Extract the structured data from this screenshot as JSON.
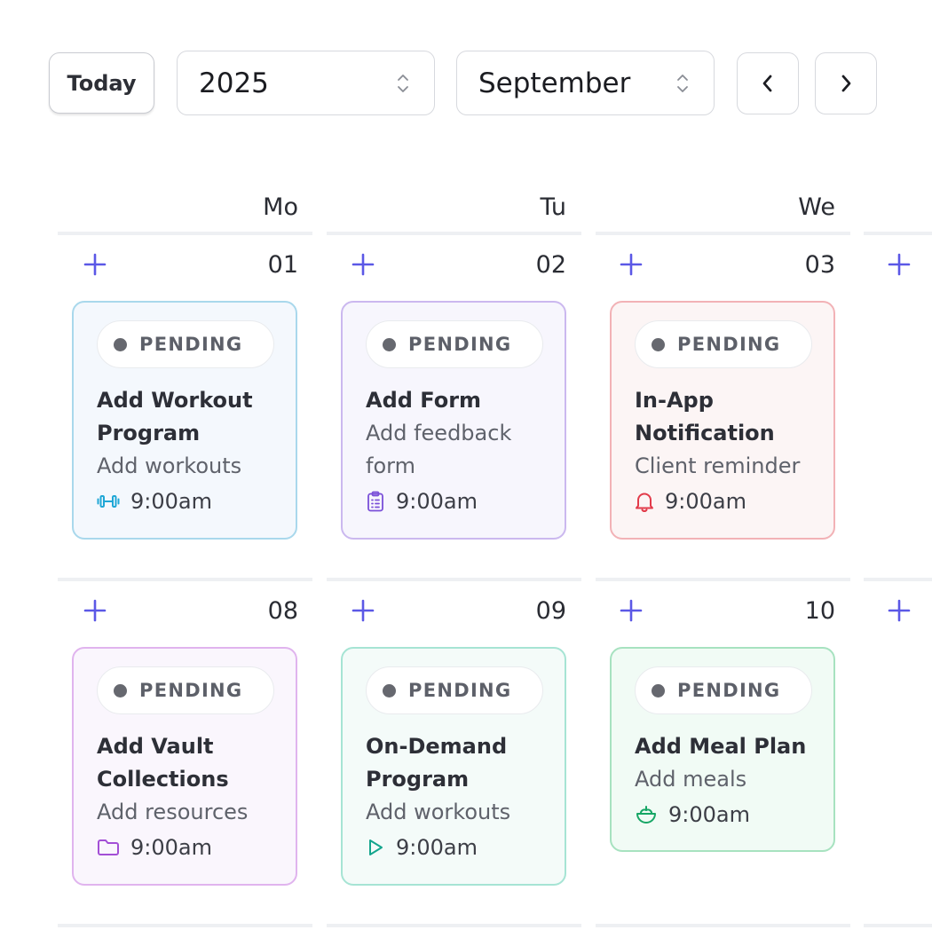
{
  "toolbar": {
    "today_label": "Today",
    "year_value": "2025",
    "month_value": "September"
  },
  "day_headers": [
    "Mo",
    "Tu",
    "We"
  ],
  "weeks": [
    {
      "dates": [
        "01",
        "02",
        "03"
      ]
    },
    {
      "dates": [
        "08",
        "09",
        "10"
      ]
    }
  ],
  "events": [
    {
      "status": "PENDING",
      "title": "Add Workout Program",
      "subtitle": "Add workouts",
      "time": "9:00am",
      "icon": "dumbbell-icon",
      "accent": "#1fa7d6"
    },
    {
      "status": "PENDING",
      "title": "Add Form",
      "subtitle": "Add feedback form",
      "time": "9:00am",
      "icon": "clipboard-icon",
      "accent": "#7a4fd8"
    },
    {
      "status": "PENDING",
      "title": "In-App Notification",
      "subtitle": "Client reminder",
      "time": "9:00am",
      "icon": "bell-icon",
      "accent": "#e23b4a"
    },
    {
      "status": "PENDING",
      "title": "Add Vault Collections",
      "subtitle": "Add resources",
      "time": "9:00am",
      "icon": "folder-icon",
      "accent": "#a34fd6"
    },
    {
      "status": "PENDING",
      "title": "On-Demand Program",
      "subtitle": "Add workouts",
      "time": "9:00am",
      "icon": "play-icon",
      "accent": "#14a58d"
    },
    {
      "status": "PENDING",
      "title": "Add Meal Plan",
      "subtitle": "Add meals",
      "time": "9:00am",
      "icon": "salad-bowl-icon",
      "accent": "#17a665"
    }
  ],
  "colors": {
    "plus_accent": "#5b58e6",
    "pending_dot": "#66686f"
  }
}
